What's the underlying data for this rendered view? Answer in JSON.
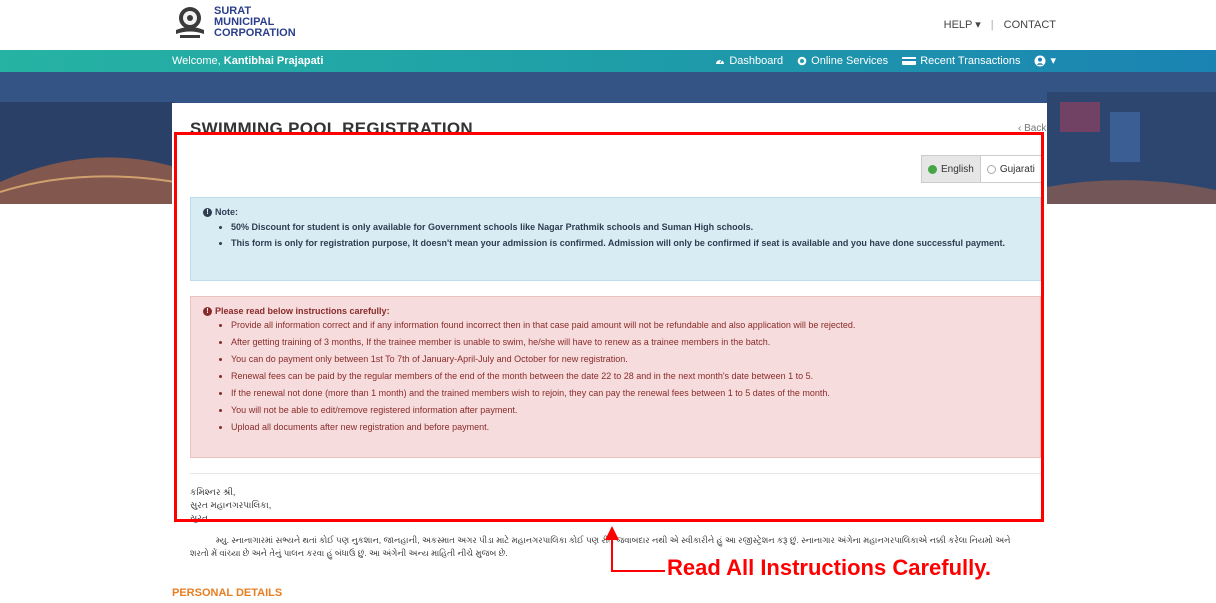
{
  "header": {
    "logo_line1": "SURAT",
    "logo_line2": "MUNICIPAL",
    "logo_line3": "CORPORATION",
    "help_label": "HELP ▾",
    "contact_label": "CONTACT"
  },
  "navbar": {
    "welcome_prefix": "Welcome, ",
    "user_name": "Kantibhai Prajapati",
    "dashboard": "Dashboard",
    "online_services": "Online Services",
    "recent_transactions": "Recent Transactions",
    "user_menu_caret": "▾"
  },
  "page": {
    "title": "SWIMMING POOL REGISTRATION",
    "back": "‹ Back",
    "lang_english": "English",
    "lang_gujarati": "Gujarati",
    "lang_selected": "English"
  },
  "note": {
    "title": "Note:",
    "items": [
      "50% Discount for student is only available for Government schools like Nagar Prathmik schools and Suman High schools.",
      "This form is only for registration purpose, It doesn't mean your admission is confirmed. Admission will only be confirmed if seat is available and you have done successful payment."
    ]
  },
  "instructions": {
    "title": "Please read below instructions carefully:",
    "items": [
      "Provide all information correct and if any information found incorrect then in that case paid amount will not be refundable and also application will be rejected.",
      "After getting training of 3 months, If the trainee member is unable to swim, he/she will have to renew as a trainee members in the batch.",
      "You can do payment only between 1st To 7th of January-April-July and October for new registration.",
      "Renewal fees can be paid by the regular members of the end of the month between the date 22 to 28 and in the next month's date between 1 to 5.",
      "If the renewal not done (more than 1 month) and the trained members wish to rejoin, they can pay the renewal fees between 1 to 5 dates of the month.",
      "You will not be able to edit/remove registered information after payment.",
      "Upload all documents after new registration and before payment."
    ]
  },
  "address": {
    "line1": "કમિશ્નર શ્રી,",
    "line2": "સુરત મહાનગરપાલિકા,",
    "line3": "સુરત."
  },
  "declaration": "મ્યુ. સ્નાનાગારમાં સભ્યને થતાં કોઈ પણ નુકશાન, જાનહાની, અકસ્માત અગર પીડા માટે મહાનગરપાલિકા કોઈ પણ રીતે જવાબદાર નથી એ સ્વીકારીને હું આ રજીસ્ટ્રેશન કરૂ છું. સ્નાનાગાર અંગેના મહાનગરપાલિકાએ નક્કી કરેલા નિયમો અને શરતો મેં વાંચ્યા છે અને તેનું પાલન કરવા હું બંધાઉ છું. આ અંગેની અન્ય માહિતી નીચે મુજબ છે.",
  "section": {
    "personal_details": "PERSONAL DETAILS"
  },
  "annotation": {
    "text": "Read All Instructions Carefully.",
    "color": "#ff0000"
  },
  "colors": {
    "navbar_start": "#26b3a3",
    "navbar_end": "#1b83b3",
    "note_bg": "#d8ecf4",
    "warn_bg": "#f6dcdc",
    "section_heading": "#e67e22"
  }
}
